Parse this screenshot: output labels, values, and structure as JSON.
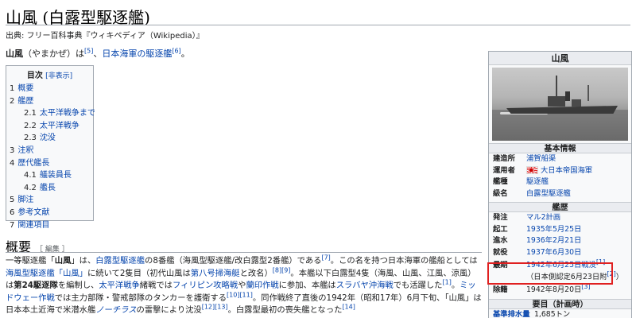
{
  "page": {
    "title": "山風 (白露型駆逐艦)",
    "site_sub": "出典: フリー百科事典『ウィキペディア（Wikipedia）』"
  },
  "lead": {
    "subject": "山風",
    "reading": "（やまかぜ）は",
    "ref1": "[5]",
    "sep": "、",
    "link": "日本海軍の駆逐艦",
    "ref2": "[6]",
    "end": "。"
  },
  "toc": {
    "title": "目次",
    "toggle": "[非表示]",
    "items": [
      {
        "num": "1",
        "label": "概要"
      },
      {
        "num": "2",
        "label": "艦歴"
      },
      {
        "num": "2.1",
        "label": "太平洋戦争まで"
      },
      {
        "num": "2.2",
        "label": "太平洋戦争"
      },
      {
        "num": "2.3",
        "label": "沈没"
      },
      {
        "num": "3",
        "label": "注釈"
      },
      {
        "num": "4",
        "label": "歴代艦長"
      },
      {
        "num": "4.1",
        "label": "艤装員長"
      },
      {
        "num": "4.2",
        "label": "艦長"
      },
      {
        "num": "5",
        "label": "脚注"
      },
      {
        "num": "6",
        "label": "参考文献"
      },
      {
        "num": "7",
        "label": "関連項目"
      }
    ]
  },
  "section": {
    "heading": "概要",
    "edit": "［ 編集 ］",
    "p": {
      "t1": "一等駆逐艦「",
      "b1": "山風",
      "t2": "」は、",
      "l1": "白露型駆逐艦",
      "t3": "の8番艦（海風型駆逐艦/改白露型2番艦）である",
      "r1": "[7]",
      "t4": "。この名を持つ日本海軍の艦船としては",
      "l2": "海風型駆逐艦「山風」",
      "t5": "に続いて2隻目（初代山風は",
      "l3": "第八号掃海艇",
      "t6": "と改名）",
      "r2": "[8][9]",
      "t7": "。本艦以下白露型4隻（海風、山風、江風、涼風）は",
      "b2": "第24駆逐隊",
      "t8": "を編制し、",
      "l4": "太平洋戦争",
      "t9": "緒戦では",
      "l5": "フィリピン攻略戦",
      "t10": "や",
      "l6": "蘭印作戦",
      "t11": "に参加、本艦は",
      "l7": "スラバヤ沖海戦",
      "t12": "でも活躍した",
      "r3": "[1]",
      "t13": "。",
      "l8": "ミッドウェー作戦",
      "t14": "では主力部隊・警戒部隊のタンカーを護衛する",
      "r4": "[10][11]",
      "t15": "。同作戦終了直後の1942年（昭和17年）6月下旬、「山風」は日本本土近海で米潜水艦",
      "l9": "ノーチラス",
      "t16": "の雷撃により沈没",
      "r5": "[12][13]",
      "t17": "。白露型最初の喪失艦となった",
      "r6": "[14]"
    }
  },
  "infobox": {
    "title": "山風",
    "sec_basic": "基本情報",
    "builder": {
      "label": "建造所",
      "value": "浦賀船渠"
    },
    "operator": {
      "label": "運用者",
      "value": "大日本帝国海軍"
    },
    "type": {
      "label": "艦種",
      "value": "駆逐艦"
    },
    "class": {
      "label": "級名",
      "value": "白露型駆逐艦"
    },
    "sec_history": "艦歴",
    "order": {
      "label": "発注",
      "value": "マル2計画"
    },
    "laid": {
      "label": "起工",
      "value": "1935年5月25日"
    },
    "launched": {
      "label": "進水",
      "value": "1936年2月21日"
    },
    "commissioned": {
      "label": "就役",
      "value": "1937年6月30日"
    },
    "fate": {
      "label": "最期",
      "value": "1942年6月25日戦没",
      "ref": "[1]",
      "note": "（日本側認定6月23日附",
      "note_ref": "[2]",
      "note_end": "）"
    },
    "removed": {
      "label": "除籍",
      "value": "1942年8月20日",
      "ref": "[3]"
    },
    "sec_specs": "要目（計画時）",
    "displacement": {
      "label": "基準排水量",
      "value": "1,685トン"
    }
  }
}
